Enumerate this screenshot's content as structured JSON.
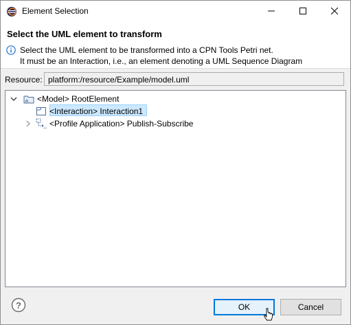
{
  "window": {
    "title": "Element Selection"
  },
  "header": {
    "title": "Select the UML element to transform",
    "info_line1": "Select the UML element to be transformed into a CPN Tools Petri net.",
    "info_line2": "It must be an Interaction, i.e., an element denoting a UML Sequence Diagram"
  },
  "resource": {
    "label": "Resource:",
    "value": "platform:/resource/Example/model.uml"
  },
  "tree": {
    "items": [
      {
        "label": "<Model> RootElement",
        "icon": "package-icon",
        "expanded": true
      },
      {
        "label": "<Interaction> Interaction1",
        "icon": "interaction-icon",
        "selected": true
      },
      {
        "label": "<Profile Application> Publish-Subscribe",
        "icon": "profile-application-icon",
        "expanded": false
      }
    ]
  },
  "buttons": {
    "ok": "OK",
    "cancel": "Cancel"
  },
  "colors": {
    "selection": "#cce8ff",
    "default_button_border": "#0078d7"
  }
}
